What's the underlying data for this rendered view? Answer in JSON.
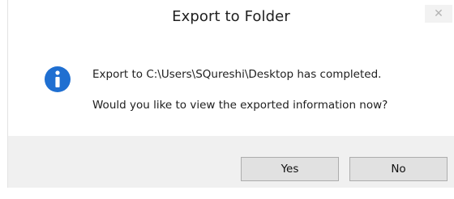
{
  "dialog": {
    "title": "Export to Folder",
    "close_glyph": "✕",
    "icon": "info-icon",
    "message_line1": "Export to C:\\Users\\SQureshi\\Desktop has completed.",
    "message_line2": "Would you like to view the exported information now?",
    "buttons": {
      "yes_label": "Yes",
      "no_label": "No"
    }
  },
  "colors": {
    "info_icon_blue": "#1f6fd1",
    "footer_bg": "#f0f0f0",
    "button_bg": "#e1e1e1",
    "button_border": "#adadad"
  }
}
